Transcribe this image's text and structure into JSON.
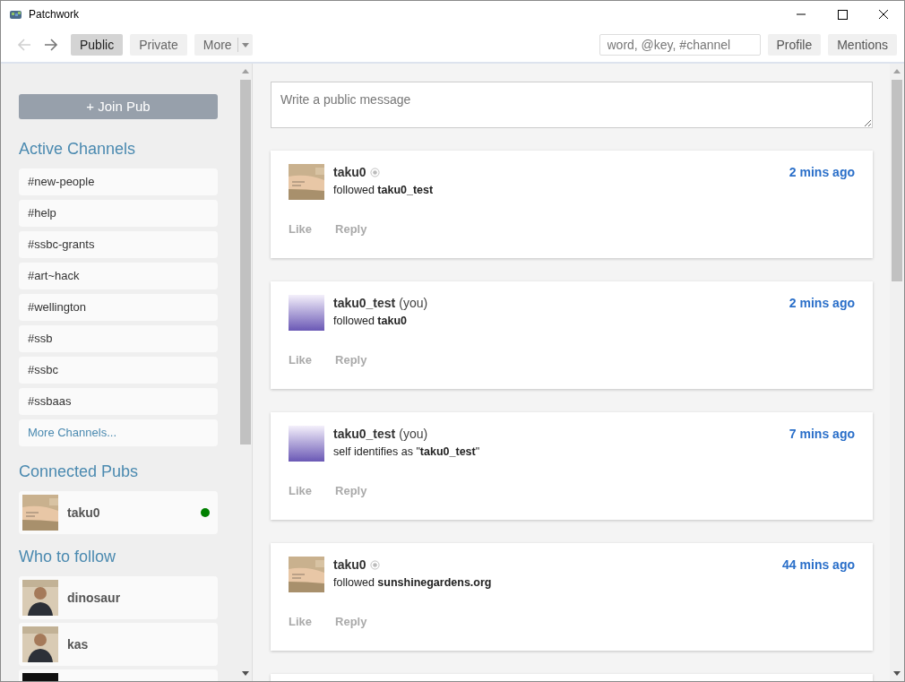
{
  "window": {
    "title": "Patchwork"
  },
  "nav": {
    "back_disabled": true,
    "forward_disabled": false
  },
  "tabs": [
    {
      "label": "Public",
      "selected": true
    },
    {
      "label": "Private",
      "selected": false
    },
    {
      "label": "More",
      "selected": false,
      "kind": "dropdown"
    }
  ],
  "search": {
    "placeholder": "word, @key, #channel"
  },
  "toolbar_buttons": [
    "Profile",
    "Mentions"
  ],
  "sidebar": {
    "join_button": "+ Join Pub",
    "channels_title": "Active Channels",
    "channels": [
      {
        "label": "#new-people",
        "kind": "channel"
      },
      {
        "label": "#help",
        "kind": "channel"
      },
      {
        "label": "#ssbc-grants",
        "kind": "channel"
      },
      {
        "label": "#art~hack",
        "kind": "channel"
      },
      {
        "label": "#wellington",
        "kind": "channel"
      },
      {
        "label": "#ssb",
        "kind": "channel"
      },
      {
        "label": "#ssbc",
        "kind": "channel"
      },
      {
        "label": "#ssbaas",
        "kind": "channel"
      },
      {
        "label": "More Channels...",
        "kind": "more"
      }
    ],
    "pubs_title": "Connected Pubs",
    "pubs": [
      {
        "name": "taku0",
        "online": true
      }
    ],
    "follow_title": "Who to follow",
    "follow": [
      {
        "name": "dinosaur",
        "kind": "picture"
      },
      {
        "name": "kas",
        "kind": "picture"
      },
      {
        "kind": "picture"
      }
    ]
  },
  "composer": {
    "placeholder": "Write a public message"
  },
  "feed": [
    {
      "author": "taku0",
      "verified": true,
      "text": "followed **taku0_test**",
      "time": "2 mins ago",
      "actions": [
        "Like",
        "Reply"
      ]
    },
    {
      "author": "taku0_test",
      "you_label": "(you)",
      "verified": false,
      "text": "followed **taku0**",
      "time": "2 mins ago",
      "actions": [
        "Like",
        "Reply"
      ]
    },
    {
      "author": "taku0_test",
      "you_label": "(you)",
      "verified": false,
      "text": "self identifies as \"**taku0_test**\"",
      "time": "7 mins ago",
      "actions": [
        "Like",
        "Reply"
      ]
    },
    {
      "author": "taku0",
      "verified": true,
      "text": "followed **sunshinegardens.org**",
      "time": "44 mins ago",
      "actions": [
        "Like",
        "Reply"
      ]
    }
  ]
}
